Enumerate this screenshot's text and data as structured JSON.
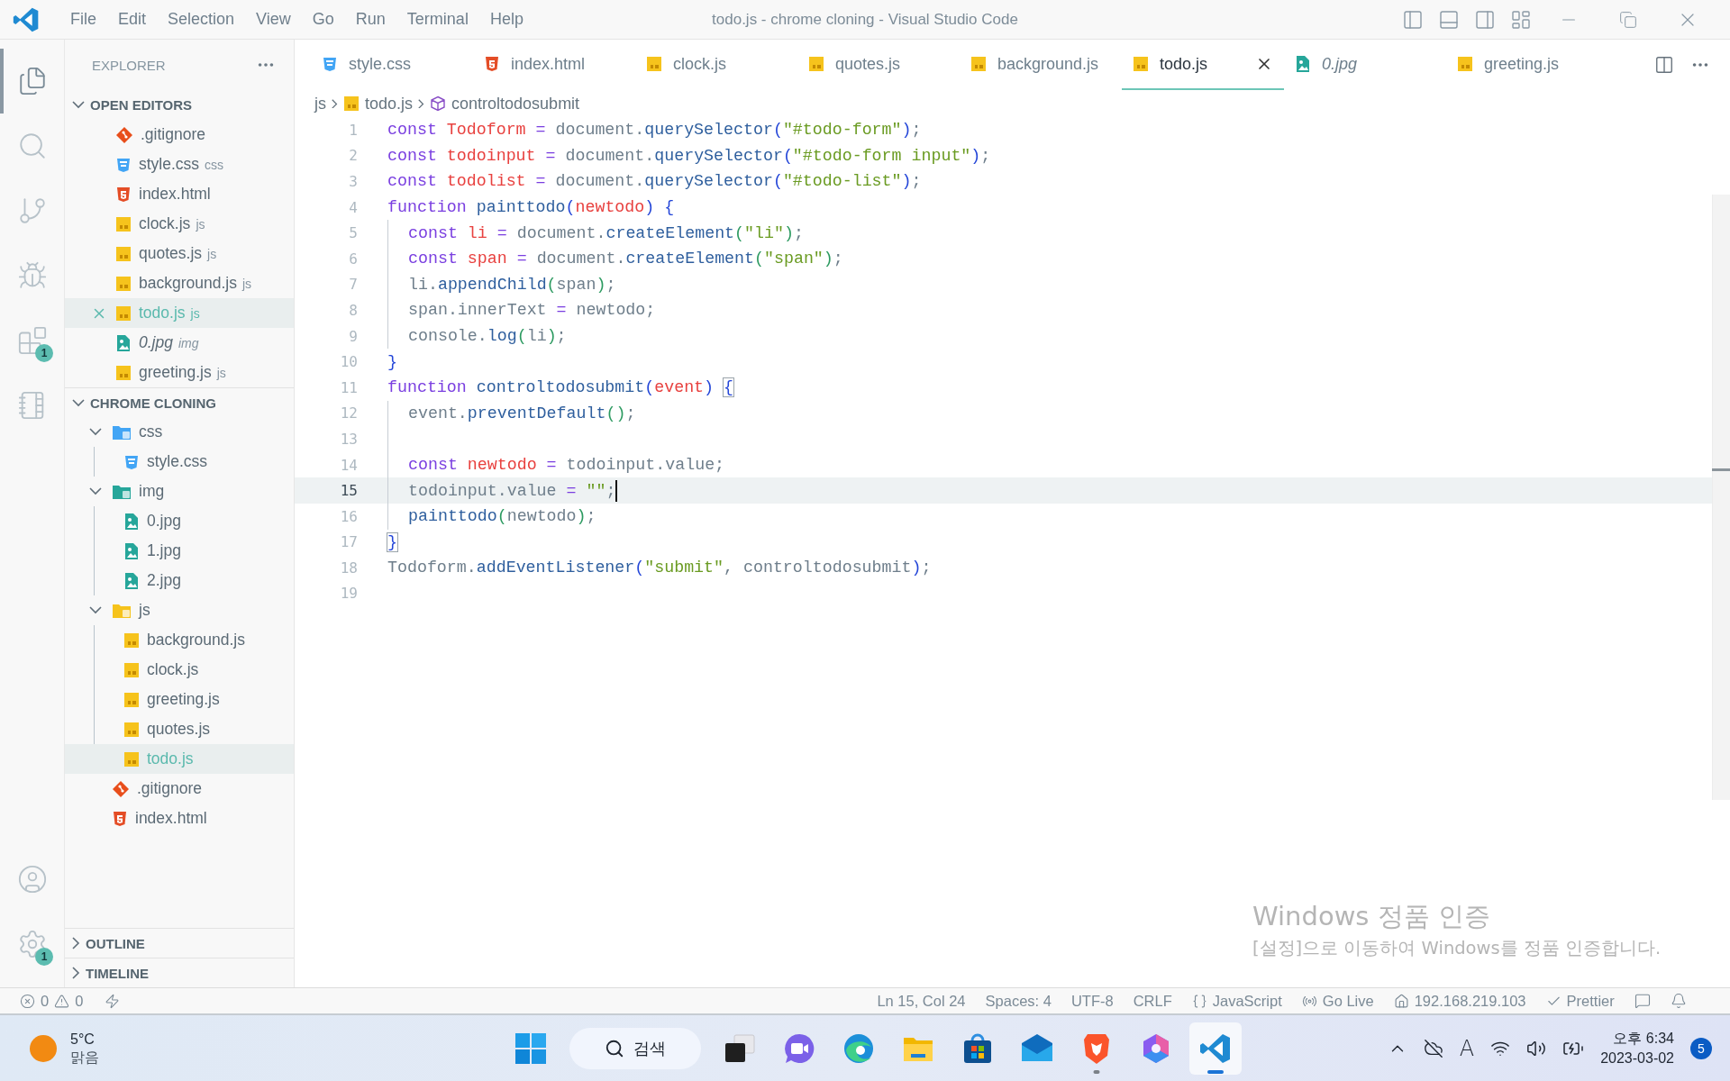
{
  "title_bar": {
    "menu": [
      "File",
      "Edit",
      "Selection",
      "View",
      "Go",
      "Run",
      "Terminal",
      "Help"
    ],
    "title": "todo.js - chrome cloning - Visual Studio Code"
  },
  "activity_bar": {
    "items": [
      {
        "kind": "explorer",
        "selected": true
      },
      {
        "kind": "search",
        "selected": false
      },
      {
        "kind": "source_control",
        "selected": false
      },
      {
        "kind": "run",
        "selected": false
      },
      {
        "kind": "extensions",
        "selected": false,
        "badge": "1"
      },
      {
        "kind": "notebook",
        "selected": false
      }
    ],
    "bottom": [
      {
        "kind": "account",
        "selected": false
      },
      {
        "kind": "settings",
        "selected": false,
        "badge": "1"
      }
    ]
  },
  "sidebar": {
    "title": "EXPLORER",
    "open_editors": {
      "title": "OPEN EDITORS",
      "expanded": true,
      "items": [
        {
          "name": ".gitignore",
          "kind": "git",
          "selected": false,
          "preview": false
        },
        {
          "name": "style.css",
          "suffix": "css",
          "kind": "css",
          "selected": false,
          "preview": false
        },
        {
          "name": "index.html",
          "kind": "html",
          "selected": false,
          "preview": false
        },
        {
          "name": "clock.js",
          "suffix": "js",
          "kind": "js",
          "selected": false,
          "preview": false
        },
        {
          "name": "quotes.js",
          "suffix": "js",
          "kind": "js",
          "selected": false,
          "preview": false
        },
        {
          "name": "background.js",
          "suffix": "js",
          "kind": "js",
          "selected": false,
          "preview": false
        },
        {
          "name": "todo.js",
          "suffix": "js",
          "kind": "js",
          "selected": true,
          "preview": false
        },
        {
          "name": "0.jpg",
          "suffix": "img",
          "kind": "image",
          "selected": false,
          "preview": true
        },
        {
          "name": "greeting.js",
          "suffix": "js",
          "kind": "js",
          "selected": false,
          "preview": false
        }
      ]
    },
    "folder": {
      "title": "CHROME CLONING",
      "expanded": true,
      "items": [
        {
          "name": "css",
          "kind": "css_folder",
          "expanded": true,
          "selected": false,
          "children": [
            {
              "name": "style.css",
              "kind": "css",
              "selected": false
            }
          ]
        },
        {
          "name": "img",
          "kind": "image_folder",
          "expanded": true,
          "selected": false,
          "children": [
            {
              "name": "0.jpg",
              "kind": "image",
              "selected": false
            },
            {
              "name": "1.jpg",
              "kind": "image",
              "selected": false
            },
            {
              "name": "2.jpg",
              "kind": "image",
              "selected": false
            }
          ]
        },
        {
          "name": "js",
          "kind": "js_folder",
          "expanded": true,
          "selected": false,
          "children": [
            {
              "name": "background.js",
              "kind": "js",
              "selected": false
            },
            {
              "name": "clock.js",
              "kind": "js",
              "selected": false
            },
            {
              "name": "greeting.js",
              "kind": "js",
              "selected": false
            },
            {
              "name": "quotes.js",
              "kind": "js",
              "selected": false
            },
            {
              "name": "todo.js",
              "kind": "js",
              "selected": true
            }
          ]
        },
        {
          "name": ".gitignore",
          "kind": "git",
          "selected": false
        },
        {
          "name": "index.html",
          "kind": "html",
          "selected": false
        }
      ]
    },
    "panels": [
      {
        "title": "OUTLINE",
        "expanded": false
      },
      {
        "title": "TIMELINE",
        "expanded": false
      }
    ]
  },
  "tabs": [
    {
      "label": "style.css",
      "kind": "css",
      "selected": false,
      "preview": false
    },
    {
      "label": "index.html",
      "kind": "html",
      "selected": false,
      "preview": false
    },
    {
      "label": "clock.js",
      "kind": "js",
      "selected": false,
      "preview": false
    },
    {
      "label": "quotes.js",
      "kind": "js",
      "selected": false,
      "preview": false
    },
    {
      "label": "background.js",
      "kind": "js",
      "selected": false,
      "preview": false
    },
    {
      "label": "todo.js",
      "kind": "js",
      "selected": true,
      "preview": false
    },
    {
      "label": "0.jpg",
      "kind": "image",
      "selected": false,
      "preview": true
    },
    {
      "label": "greeting.js",
      "kind": "js",
      "selected": false,
      "preview": false
    }
  ],
  "breadcrumb": [
    {
      "label": "js"
    },
    {
      "label": "todo.js",
      "kind": "js"
    },
    {
      "label": "controltodosubmit",
      "kind": "function"
    }
  ],
  "editor": {
    "lines": [
      {
        "number": "1",
        "current": false,
        "indented": false,
        "tokens": [
          {
            "kind": "keyword",
            "text": "const "
          },
          {
            "kind": "name",
            "text": "Todoform"
          },
          {
            "kind": "operator",
            "text": " = "
          },
          {
            "kind": "plain",
            "text": "document."
          },
          {
            "kind": "method",
            "text": "querySelector"
          },
          {
            "kind": "bracket",
            "text": "("
          },
          {
            "kind": "string",
            "text": "\"#todo-form\""
          },
          {
            "kind": "bracket",
            "text": ")"
          },
          {
            "kind": "plain",
            "text": ";"
          }
        ]
      },
      {
        "number": "2",
        "current": false,
        "indented": false,
        "tokens": [
          {
            "kind": "keyword",
            "text": "const "
          },
          {
            "kind": "name",
            "text": "todoinput"
          },
          {
            "kind": "operator",
            "text": " = "
          },
          {
            "kind": "plain",
            "text": "document."
          },
          {
            "kind": "method",
            "text": "querySelector"
          },
          {
            "kind": "bracket",
            "text": "("
          },
          {
            "kind": "string",
            "text": "\"#todo-form input\""
          },
          {
            "kind": "bracket",
            "text": ")"
          },
          {
            "kind": "plain",
            "text": ";"
          }
        ]
      },
      {
        "number": "3",
        "current": false,
        "indented": false,
        "tokens": [
          {
            "kind": "keyword",
            "text": "const "
          },
          {
            "kind": "name",
            "text": "todolist"
          },
          {
            "kind": "operator",
            "text": " = "
          },
          {
            "kind": "plain",
            "text": "document."
          },
          {
            "kind": "method",
            "text": "querySelector"
          },
          {
            "kind": "bracket",
            "text": "("
          },
          {
            "kind": "string",
            "text": "\"#todo-list\""
          },
          {
            "kind": "bracket",
            "text": ")"
          },
          {
            "kind": "plain",
            "text": ";"
          }
        ]
      },
      {
        "number": "4",
        "current": false,
        "indented": false,
        "tokens": [
          {
            "kind": "keyword",
            "text": "function "
          },
          {
            "kind": "method",
            "text": "painttodo"
          },
          {
            "kind": "bracket",
            "text": "("
          },
          {
            "kind": "name",
            "text": "newtodo"
          },
          {
            "kind": "bracket",
            "text": ") "
          },
          {
            "kind": "bracket",
            "text": "{"
          }
        ]
      },
      {
        "number": "5",
        "current": false,
        "indented": true,
        "tokens": [
          {
            "kind": "keyword",
            "text": "const "
          },
          {
            "kind": "name",
            "text": "li"
          },
          {
            "kind": "operator",
            "text": " = "
          },
          {
            "kind": "plain",
            "text": "document."
          },
          {
            "kind": "method",
            "text": "createElement"
          },
          {
            "kind": "bracket2",
            "text": "("
          },
          {
            "kind": "string",
            "text": "\"li\""
          },
          {
            "kind": "bracket2",
            "text": ")"
          },
          {
            "kind": "plain",
            "text": ";"
          }
        ]
      },
      {
        "number": "6",
        "current": false,
        "indented": true,
        "tokens": [
          {
            "kind": "keyword",
            "text": "const "
          },
          {
            "kind": "name",
            "text": "span"
          },
          {
            "kind": "operator",
            "text": " = "
          },
          {
            "kind": "plain",
            "text": "document."
          },
          {
            "kind": "method",
            "text": "createElement"
          },
          {
            "kind": "bracket2",
            "text": "("
          },
          {
            "kind": "string",
            "text": "\"span\""
          },
          {
            "kind": "bracket2",
            "text": ")"
          },
          {
            "kind": "plain",
            "text": ";"
          }
        ]
      },
      {
        "number": "7",
        "current": false,
        "indented": true,
        "tokens": [
          {
            "kind": "plain",
            "text": "li."
          },
          {
            "kind": "method",
            "text": "appendChild"
          },
          {
            "kind": "bracket2",
            "text": "("
          },
          {
            "kind": "plain",
            "text": "span"
          },
          {
            "kind": "bracket2",
            "text": ")"
          },
          {
            "kind": "plain",
            "text": ";"
          }
        ]
      },
      {
        "number": "8",
        "current": false,
        "indented": true,
        "tokens": [
          {
            "kind": "plain",
            "text": "span.innerText"
          },
          {
            "kind": "operator",
            "text": " = "
          },
          {
            "kind": "plain",
            "text": "newtodo;"
          }
        ]
      },
      {
        "number": "9",
        "current": false,
        "indented": true,
        "tokens": [
          {
            "kind": "plain",
            "text": "console."
          },
          {
            "kind": "method",
            "text": "log"
          },
          {
            "kind": "bracket2",
            "text": "("
          },
          {
            "kind": "plain",
            "text": "li"
          },
          {
            "kind": "bracket2",
            "text": ")"
          },
          {
            "kind": "plain",
            "text": ";"
          }
        ]
      },
      {
        "number": "10",
        "current": false,
        "indented": false,
        "tokens": [
          {
            "kind": "bracket",
            "text": "}"
          }
        ]
      },
      {
        "number": "11",
        "current": false,
        "indented": false,
        "tokens": [
          {
            "kind": "keyword",
            "text": "function "
          },
          {
            "kind": "method",
            "text": "controltodosubmit"
          },
          {
            "kind": "bracket",
            "text": "("
          },
          {
            "kind": "name",
            "text": "event"
          },
          {
            "kind": "bracket",
            "text": ") "
          },
          {
            "kind": "matched",
            "text": "{"
          }
        ]
      },
      {
        "number": "12",
        "current": false,
        "indented": true,
        "tokens": [
          {
            "kind": "plain",
            "text": "event."
          },
          {
            "kind": "method",
            "text": "preventDefault"
          },
          {
            "kind": "bracket2",
            "text": "()"
          },
          {
            "kind": "plain",
            "text": ";"
          }
        ]
      },
      {
        "number": "13",
        "current": false,
        "indented": true
      },
      {
        "number": "14",
        "current": false,
        "indented": true,
        "tokens": [
          {
            "kind": "keyword",
            "text": "const "
          },
          {
            "kind": "name",
            "text": "newtodo"
          },
          {
            "kind": "operator",
            "text": " = "
          },
          {
            "kind": "plain",
            "text": "todoinput.value;"
          }
        ]
      },
      {
        "number": "15",
        "current": true,
        "indented": true,
        "tokens": [
          {
            "kind": "plain",
            "text": "todoinput.value"
          },
          {
            "kind": "operator",
            "text": " = "
          },
          {
            "kind": "string",
            "text": "\"\""
          },
          {
            "kind": "plain",
            "text": ";"
          }
        ]
      },
      {
        "number": "16",
        "current": false,
        "indented": true,
        "tokens": [
          {
            "kind": "method",
            "text": "painttodo"
          },
          {
            "kind": "bracket2",
            "text": "("
          },
          {
            "kind": "plain",
            "text": "newtodo"
          },
          {
            "kind": "bracket2",
            "text": ")"
          },
          {
            "kind": "plain",
            "text": ";"
          }
        ]
      },
      {
        "number": "17",
        "current": false,
        "indented": false,
        "tokens": [
          {
            "kind": "matched",
            "text": "}"
          }
        ]
      },
      {
        "number": "18",
        "current": false,
        "indented": false,
        "tokens": [
          {
            "kind": "plain",
            "text": "Todoform."
          },
          {
            "kind": "method",
            "text": "addEventListener"
          },
          {
            "kind": "bracket",
            "text": "("
          },
          {
            "kind": "string",
            "text": "\"submit\""
          },
          {
            "kind": "plain",
            "text": ", controltodosubmit"
          },
          {
            "kind": "bracket",
            "text": ")"
          },
          {
            "kind": "plain",
            "text": ";"
          }
        ]
      },
      {
        "number": "19",
        "current": false,
        "indented": false
      }
    ]
  },
  "activation_notice": {
    "title": "Windows 정품 인증",
    "message": "[설정]으로 이동하여 Windows를 정품 인증합니다."
  },
  "status_bar": {
    "errors": "0",
    "warnings": "0",
    "items": [
      {
        "kind": "plain",
        "text": "Ln 15, Col 24"
      },
      {
        "kind": "plain",
        "text": "Spaces: 4"
      },
      {
        "kind": "plain",
        "text": "UTF-8"
      },
      {
        "kind": "plain",
        "text": "CRLF"
      },
      {
        "kind": "language",
        "text": "JavaScript"
      },
      {
        "kind": "live",
        "text": "Go Live"
      },
      {
        "kind": "host",
        "text": "192.168.219.103"
      },
      {
        "kind": "check",
        "text": "Prettier"
      }
    ]
  },
  "taskbar": {
    "weather": {
      "temperature": "5°C",
      "condition": "맑음"
    },
    "search": {
      "label": "검색"
    },
    "apps": [
      {
        "kind": "start",
        "running": false,
        "active": false
      },
      {
        "kind": "task_view",
        "running": false,
        "active": false
      },
      {
        "kind": "video_chat",
        "running": false,
        "active": false
      },
      {
        "kind": "browser",
        "running": false,
        "active": false
      },
      {
        "kind": "files",
        "running": false,
        "active": false
      },
      {
        "kind": "store",
        "running": false,
        "active": false
      },
      {
        "kind": "mail",
        "running": false,
        "active": false
      },
      {
        "kind": "shield_browser",
        "running": true,
        "active": false
      },
      {
        "kind": "assistant",
        "running": false,
        "active": false
      },
      {
        "kind": "code",
        "running": true,
        "active": true
      }
    ],
    "input_method": "A",
    "time": "오후 6:34",
    "date": "2023-03-02",
    "notifications": "5"
  }
}
